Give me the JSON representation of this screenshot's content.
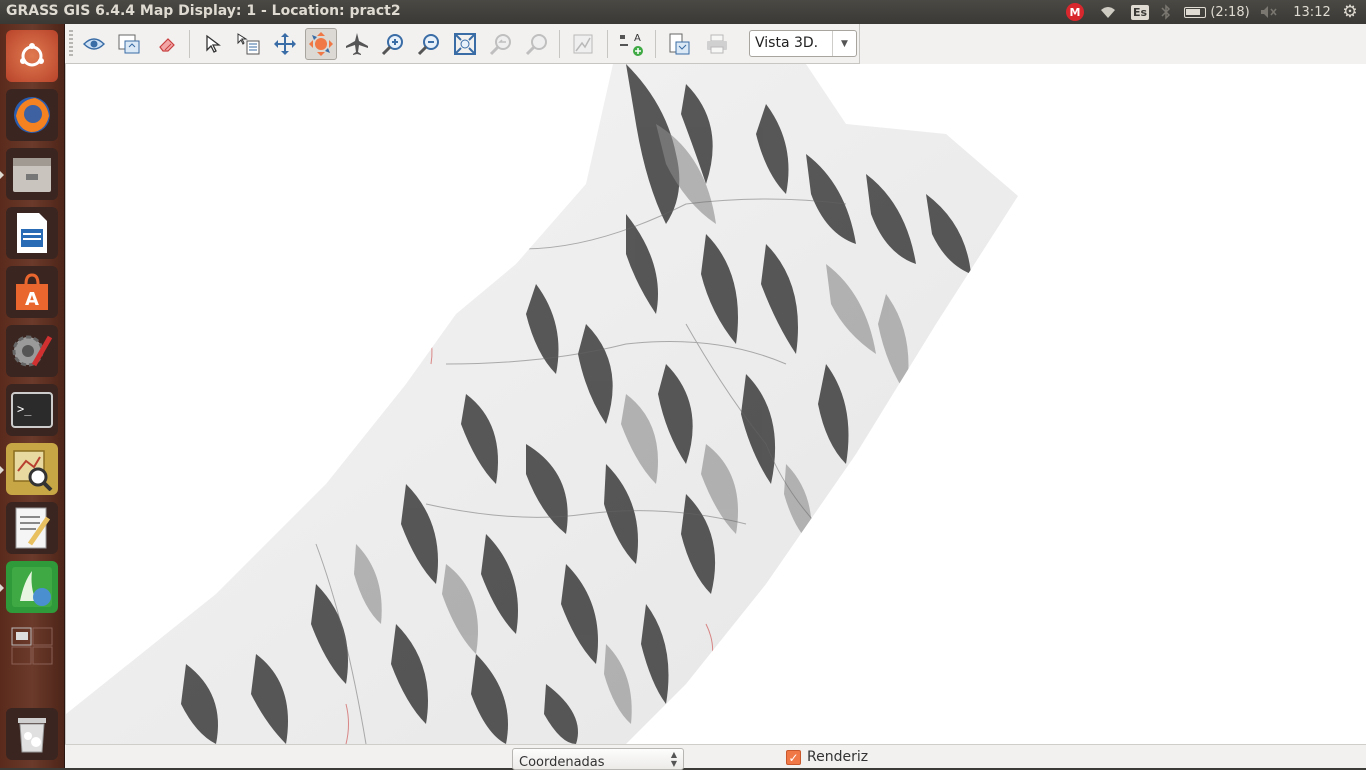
{
  "window": {
    "title": "GRASS GIS 6.4.4 Map Display: 1  - Location: pract2"
  },
  "panel": {
    "keyboard_layout": "Es",
    "battery": "(2:18)",
    "clock": "13:12",
    "mega_letter": "M"
  },
  "launcher": {
    "items": [
      {
        "name": "ubuntu-dash",
        "color": "#d04f2a"
      },
      {
        "name": "firefox",
        "color": "#e66000"
      },
      {
        "name": "files",
        "color": "#8a8a8a"
      },
      {
        "name": "libreoffice-writer",
        "color": "#2a6bb5"
      },
      {
        "name": "software-center",
        "color": "#e9672e"
      },
      {
        "name": "system-settings",
        "color": "#777"
      },
      {
        "name": "terminal",
        "color": "#2b2b2b"
      },
      {
        "name": "grass-gis",
        "color": "#c4a84a"
      },
      {
        "name": "text-editor",
        "color": "#ddd"
      },
      {
        "name": "grass-gis-layer-manager",
        "color": "#3c9a3c"
      },
      {
        "name": "workspace-switcher",
        "color": "#5a3025"
      },
      {
        "name": "trash",
        "color": "#888"
      }
    ]
  },
  "toolbar": {
    "view_mode": "Vista 3D.",
    "tools": [
      "display-map-icon",
      "render-map-icon",
      "erase-display-icon",
      "pointer-icon",
      "query-icon",
      "pan-icon",
      "rotate-3d-icon",
      "fly-through-icon",
      "zoom-in-icon",
      "zoom-out-icon",
      "zoom-extent-icon",
      "zoom-back-icon",
      "zoom-menu-icon",
      "analyze-icon",
      "overlay-icon",
      "save-image-icon",
      "print-icon"
    ]
  },
  "statusbar": {
    "coords_mode": "Coordenadas",
    "render_label": "Renderiz",
    "render_checked": true
  },
  "colors": {
    "panel_bg": "#3c3b37",
    "toolbar_bg": "#f2f1f0",
    "accent_orange": "#f07746",
    "launcher_bg": "#5a2a1c"
  }
}
